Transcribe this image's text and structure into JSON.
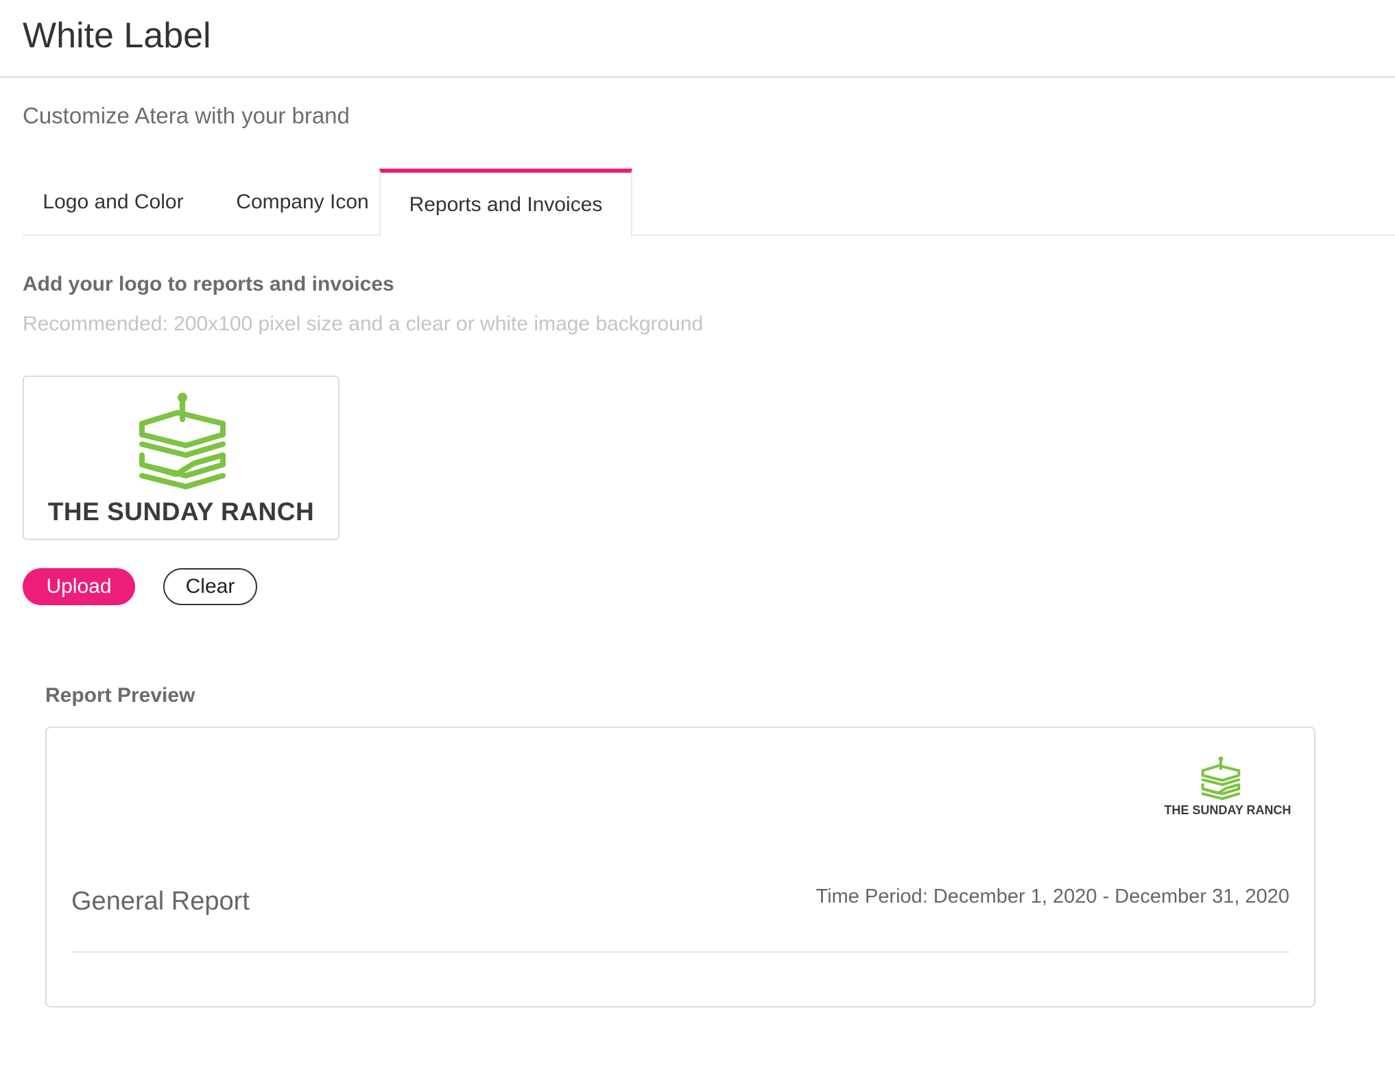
{
  "header": {
    "title": "White Label"
  },
  "subtitle": "Customize Atera with your brand",
  "tabs": [
    {
      "label": "Logo and Color",
      "active": false
    },
    {
      "label": "Company Icon",
      "active": false
    },
    {
      "label": "Reports and Invoices",
      "active": true
    }
  ],
  "section": {
    "heading": "Add your logo to reports and invoices",
    "hint": "Recommended: 200x100 pixel size and a clear or white image background"
  },
  "logo": {
    "text": "THE SUNDAY RANCH",
    "icon": "sandwich-icon",
    "icon_color": "#7dc242"
  },
  "buttons": {
    "upload": "Upload",
    "clear": "Clear"
  },
  "preview": {
    "label": "Report Preview",
    "report_title": "General Report",
    "time_period": "Time Period: December 1, 2020 - December 31, 2020"
  },
  "colors": {
    "accent": "#ed1e79",
    "text": "#333333",
    "muted": "#6b6b6b",
    "hint": "#c4c4c4",
    "border": "#dcdcdc"
  }
}
